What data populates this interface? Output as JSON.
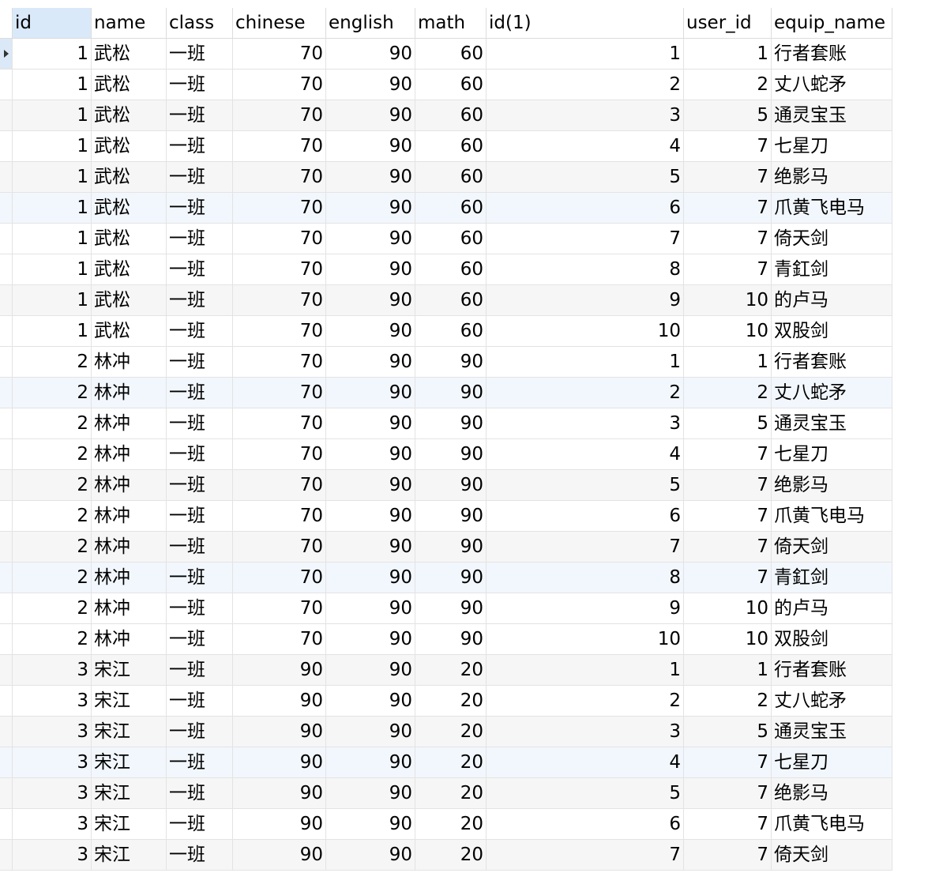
{
  "columns": [
    "id",
    "name",
    "class",
    "chinese",
    "english",
    "math",
    "id(1)",
    "user_id",
    "equip_name"
  ],
  "rows": [
    [
      "1",
      "武松",
      "一班",
      "70",
      "90",
      "60",
      "1",
      "1",
      "行者套账"
    ],
    [
      "1",
      "武松",
      "一班",
      "70",
      "90",
      "60",
      "2",
      "2",
      "丈八蛇矛"
    ],
    [
      "1",
      "武松",
      "一班",
      "70",
      "90",
      "60",
      "3",
      "5",
      "通灵宝玉"
    ],
    [
      "1",
      "武松",
      "一班",
      "70",
      "90",
      "60",
      "4",
      "7",
      "七星刀"
    ],
    [
      "1",
      "武松",
      "一班",
      "70",
      "90",
      "60",
      "5",
      "7",
      "绝影马"
    ],
    [
      "1",
      "武松",
      "一班",
      "70",
      "90",
      "60",
      "6",
      "7",
      "爪黄飞电马"
    ],
    [
      "1",
      "武松",
      "一班",
      "70",
      "90",
      "60",
      "7",
      "7",
      "倚天剑"
    ],
    [
      "1",
      "武松",
      "一班",
      "70",
      "90",
      "60",
      "8",
      "7",
      "青釭剑"
    ],
    [
      "1",
      "武松",
      "一班",
      "70",
      "90",
      "60",
      "9",
      "10",
      "的卢马"
    ],
    [
      "1",
      "武松",
      "一班",
      "70",
      "90",
      "60",
      "10",
      "10",
      "双股剑"
    ],
    [
      "2",
      "林冲",
      "一班",
      "70",
      "90",
      "90",
      "1",
      "1",
      "行者套账"
    ],
    [
      "2",
      "林冲",
      "一班",
      "70",
      "90",
      "90",
      "2",
      "2",
      "丈八蛇矛"
    ],
    [
      "2",
      "林冲",
      "一班",
      "70",
      "90",
      "90",
      "3",
      "5",
      "通灵宝玉"
    ],
    [
      "2",
      "林冲",
      "一班",
      "70",
      "90",
      "90",
      "4",
      "7",
      "七星刀"
    ],
    [
      "2",
      "林冲",
      "一班",
      "70",
      "90",
      "90",
      "5",
      "7",
      "绝影马"
    ],
    [
      "2",
      "林冲",
      "一班",
      "70",
      "90",
      "90",
      "6",
      "7",
      "爪黄飞电马"
    ],
    [
      "2",
      "林冲",
      "一班",
      "70",
      "90",
      "90",
      "7",
      "7",
      "倚天剑"
    ],
    [
      "2",
      "林冲",
      "一班",
      "70",
      "90",
      "90",
      "8",
      "7",
      "青釭剑"
    ],
    [
      "2",
      "林冲",
      "一班",
      "70",
      "90",
      "90",
      "9",
      "10",
      "的卢马"
    ],
    [
      "2",
      "林冲",
      "一班",
      "70",
      "90",
      "90",
      "10",
      "10",
      "双股剑"
    ],
    [
      "3",
      "宋江",
      "一班",
      "90",
      "90",
      "20",
      "1",
      "1",
      "行者套账"
    ],
    [
      "3",
      "宋江",
      "一班",
      "90",
      "90",
      "20",
      "2",
      "2",
      "丈八蛇矛"
    ],
    [
      "3",
      "宋江",
      "一班",
      "90",
      "90",
      "20",
      "3",
      "5",
      "通灵宝玉"
    ],
    [
      "3",
      "宋江",
      "一班",
      "90",
      "90",
      "20",
      "4",
      "7",
      "七星刀"
    ],
    [
      "3",
      "宋江",
      "一班",
      "90",
      "90",
      "20",
      "5",
      "7",
      "绝影马"
    ],
    [
      "3",
      "宋江",
      "一班",
      "90",
      "90",
      "20",
      "6",
      "7",
      "爪黄飞电马"
    ],
    [
      "3",
      "宋江",
      "一班",
      "90",
      "90",
      "20",
      "7",
      "7",
      "倚天剑"
    ]
  ],
  "colors": {
    "header_sorted": "#d9e9f9",
    "row_alt": "#f6f6f6",
    "row_highlight": "#f2f7fd",
    "grid_line": "#e3e3e3"
  },
  "icons": {
    "row_pointer": "row-pointer-icon"
  }
}
